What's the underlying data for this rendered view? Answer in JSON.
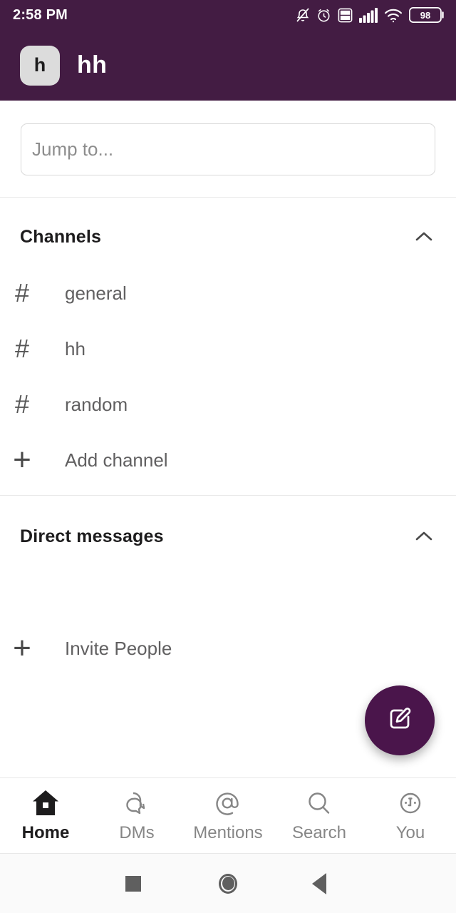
{
  "status_bar": {
    "time": "2:58 PM",
    "battery_percent": "98",
    "icons": [
      "notifications-off-icon",
      "alarm-icon",
      "volte-icon",
      "cellular-signal-icon",
      "wifi-icon",
      "battery-icon"
    ],
    "volte_label": "VoLTE"
  },
  "workspace": {
    "avatar_letter": "h",
    "name": "hh"
  },
  "search": {
    "placeholder": "Jump to...",
    "value": ""
  },
  "channels_section": {
    "title": "Channels",
    "collapse_icon": "chevron-up-icon",
    "items": [
      {
        "icon": "hash-icon",
        "glyph": "#",
        "label": "general"
      },
      {
        "icon": "hash-icon",
        "glyph": "#",
        "label": "hh"
      },
      {
        "icon": "hash-icon",
        "glyph": "#",
        "label": "random"
      },
      {
        "icon": "plus-icon",
        "glyph": "+",
        "label": "Add channel"
      }
    ]
  },
  "dm_section": {
    "title": "Direct messages",
    "collapse_icon": "chevron-up-icon",
    "items": [
      {
        "icon": "plus-icon",
        "glyph": "+",
        "label": "Invite People"
      }
    ]
  },
  "fab": {
    "icon": "compose-icon",
    "color": "#4A154B"
  },
  "bottom_nav": {
    "items": [
      {
        "icon": "home-icon",
        "label": "Home",
        "active": true
      },
      {
        "icon": "dms-icon",
        "label": "DMs",
        "active": false
      },
      {
        "icon": "mentions-icon",
        "label": "Mentions",
        "active": false
      },
      {
        "icon": "search-icon",
        "label": "Search",
        "active": false
      },
      {
        "icon": "you-icon",
        "label": "You",
        "active": false
      }
    ]
  },
  "system_nav": {
    "recents": "recents-square-icon",
    "home": "home-circle-icon",
    "back": "back-triangle-icon"
  },
  "colors": {
    "header_purple": "#431C43",
    "accent_purple": "#4A154B",
    "text_primary": "#1D1C1D",
    "text_secondary": "#616061",
    "divider": "#E8E8E8"
  }
}
